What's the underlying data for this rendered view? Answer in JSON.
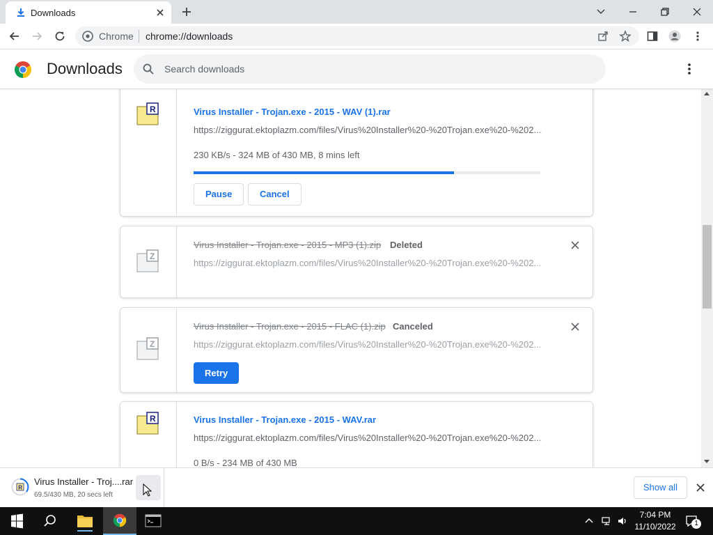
{
  "tab": {
    "title": "Downloads",
    "icon": "download-icon"
  },
  "toolbar": {
    "site_label": "Chrome",
    "url": "chrome://downloads"
  },
  "header": {
    "title": "Downloads",
    "search_placeholder": "Search downloads"
  },
  "downloads": [
    {
      "name": "Virus Installer - Trojan.exe - 2015 - WAV (1).rar",
      "url": "https://ziggurat.ektoplazm.com/files/Virus%20Installer%20-%20Trojan.exe%20-%202...",
      "status": "230 KB/s - 324 MB of 430 MB, 8 mins left",
      "progress": 0.75,
      "buttons": {
        "pause": "Pause",
        "cancel": "Cancel"
      },
      "icon": "rar-archive-icon"
    },
    {
      "name": "Virus Installer - Trojan.exe - 2015 - MP3 (1).zip",
      "tag": "Deleted",
      "url": "https://ziggurat.ektoplazm.com/files/Virus%20Installer%20-%20Trojan.exe%20-%202...",
      "icon": "zip-archive-icon"
    },
    {
      "name": "Virus Installer - Trojan.exe - 2015 - FLAC (1).zip",
      "tag": "Canceled",
      "url": "https://ziggurat.ektoplazm.com/files/Virus%20Installer%20-%20Trojan.exe%20-%202...",
      "buttons": {
        "retry": "Retry"
      },
      "icon": "zip-archive-icon"
    },
    {
      "name": "Virus Installer - Trojan.exe - 2015 - WAV.rar",
      "url": "https://ziggurat.ektoplazm.com/files/Virus%20Installer%20-%20Trojan.exe%20-%202...",
      "status": "0 B/s - 234 MB of 430 MB",
      "icon": "rar-archive-icon"
    }
  ],
  "shelf": {
    "name": "Virus Installer - Troj....rar",
    "status": "69.5/430 MB, 20 secs left",
    "show_all": "Show all"
  },
  "taskbar": {
    "time": "7:04 PM",
    "date": "11/10/2022",
    "notifications": "1"
  },
  "colors": {
    "accent": "#1a73e8",
    "tabstrip": "#dee1e6",
    "taskbar": "#101010"
  }
}
